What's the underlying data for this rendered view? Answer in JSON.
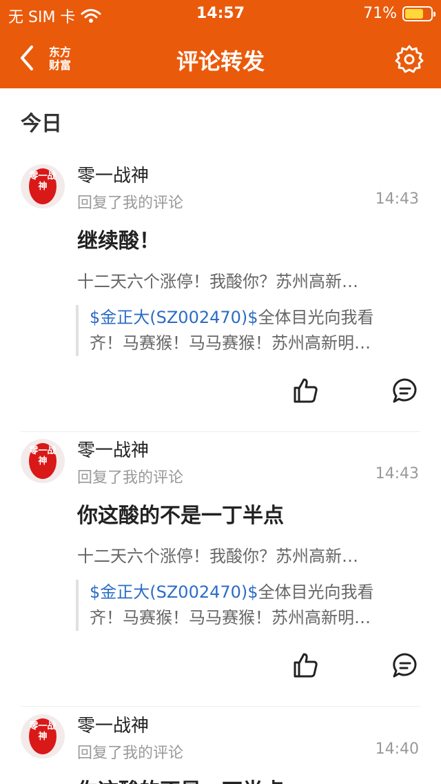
{
  "status_bar": {
    "carrier": "无 SIM 卡",
    "time": "14:57",
    "battery": "71%",
    "battery_level": 0.71
  },
  "header": {
    "back_icon": "chevron-left-icon",
    "logo_text_1": "东方",
    "logo_text_2": "财富",
    "title": "评论转发",
    "settings_icon": "gear-icon"
  },
  "section_title": "今日",
  "colors": {
    "brand": "#ea5a0b",
    "stock_link": "#2b6cc4",
    "seal_red": "#d91818"
  },
  "comments": [
    {
      "avatar_text": "零一战神",
      "username": "零一战神",
      "action": "回复了我的评论",
      "time": "14:43",
      "content": "继续酸！",
      "original": "十二天六个涨停！我酸你？苏州高新…",
      "quote_stock": "$金正大(SZ002470)$",
      "quote_line1_rest": "全体目光向我看",
      "quote_line2": "齐！马赛猴！马马赛猴！苏州高新明…"
    },
    {
      "avatar_text": "零一战神",
      "username": "零一战神",
      "action": "回复了我的评论",
      "time": "14:43",
      "content": "你这酸的不是一丁半点",
      "original": "十二天六个涨停！我酸你？苏州高新…",
      "quote_stock": "$金正大(SZ002470)$",
      "quote_line1_rest": "全体目光向我看",
      "quote_line2": "齐！马赛猴！马马赛猴！苏州高新明…"
    },
    {
      "avatar_text": "零一战神",
      "username": "零一战神",
      "action": "回复了我的评论",
      "time": "14:40",
      "content": "你这酸的不是一丁半点",
      "original": "",
      "quote_stock": "",
      "quote_line1_rest": "",
      "quote_line2": ""
    }
  ]
}
